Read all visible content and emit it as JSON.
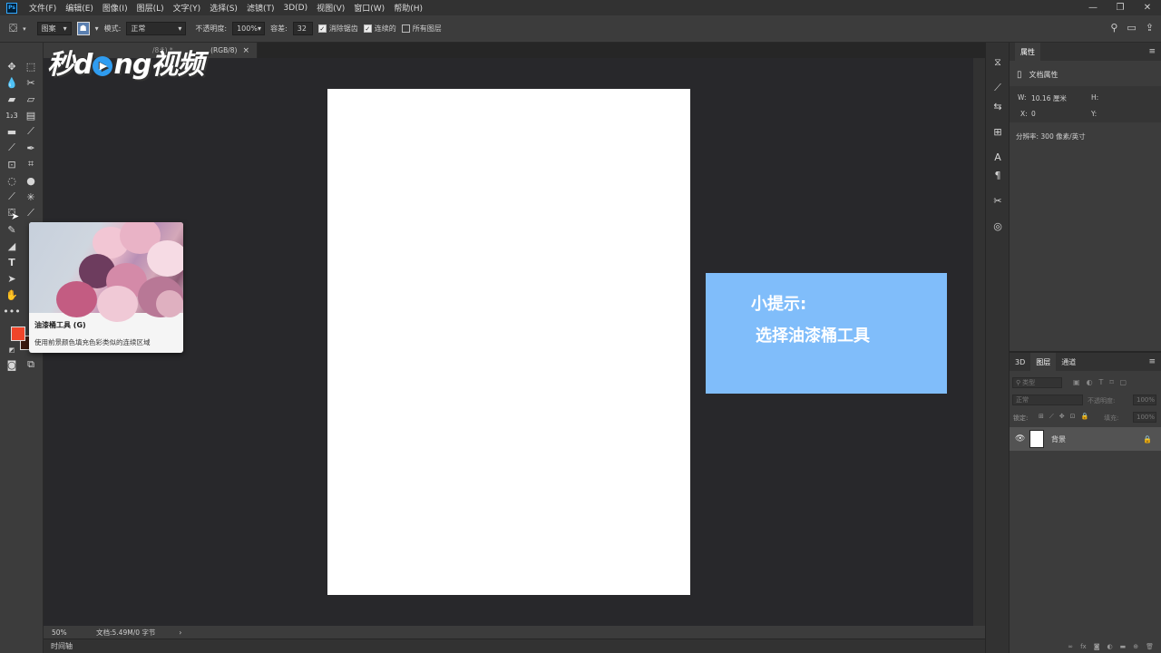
{
  "menubar": {
    "logo": "Ps",
    "items": [
      "文件(F)",
      "编辑(E)",
      "图像(I)",
      "图层(L)",
      "文字(Y)",
      "选择(S)",
      "滤镜(T)",
      "3D(D)",
      "视图(V)",
      "窗口(W)",
      "帮助(H)"
    ],
    "minimize": "—",
    "maximize": "❐",
    "close": "✕"
  },
  "options": {
    "fill_source": "图案",
    "mode_label": "模式:",
    "mode_value": "正常",
    "opacity_label": "不透明度:",
    "opacity_value": "100%",
    "tolerance_label": "容差:",
    "tolerance_value": "32",
    "antialias_label": "消除锯齿",
    "contiguous_label": "连续的",
    "all_layers_label": "所有图层"
  },
  "document": {
    "tab_title": "(RGB/8)",
    "tab_close": "×",
    "tab_fragment": "/8#) *",
    "zoom": "50%",
    "doc_info": "文档:5.49M/0 字节",
    "timeline": "时间轴"
  },
  "watermark": {
    "part1": "秒d",
    "play": "▶",
    "part2": "ng视频"
  },
  "tooltip": {
    "title": "油漆桶工具 (G)",
    "description": "使用前景颜色填充色彩类似的连续区域"
  },
  "tip": {
    "title": "小提示:",
    "text": "选择油漆桶工具"
  },
  "properties": {
    "panel_title": "属性",
    "section": "文档属性",
    "w_label": "W:",
    "w_value": "10.16 厘米",
    "h_label": "H:",
    "x_label": "X:",
    "x_value": "0",
    "y_label": "Y:",
    "resolution": "分辨率: 300 像素/英寸"
  },
  "layers": {
    "tabs": [
      "3D",
      "图层",
      "通道"
    ],
    "search_placeholder": "类型",
    "blend_mode": "正常",
    "opacity_label": "不透明度:",
    "opacity_value": "100%",
    "lock_label": "锁定:",
    "fill_label": "填充:",
    "fill_value": "100%",
    "layer_name": "背景"
  },
  "colors": {
    "foreground": "#f0452a",
    "background": "#3a1a10",
    "tip_box": "#80bdfa"
  }
}
